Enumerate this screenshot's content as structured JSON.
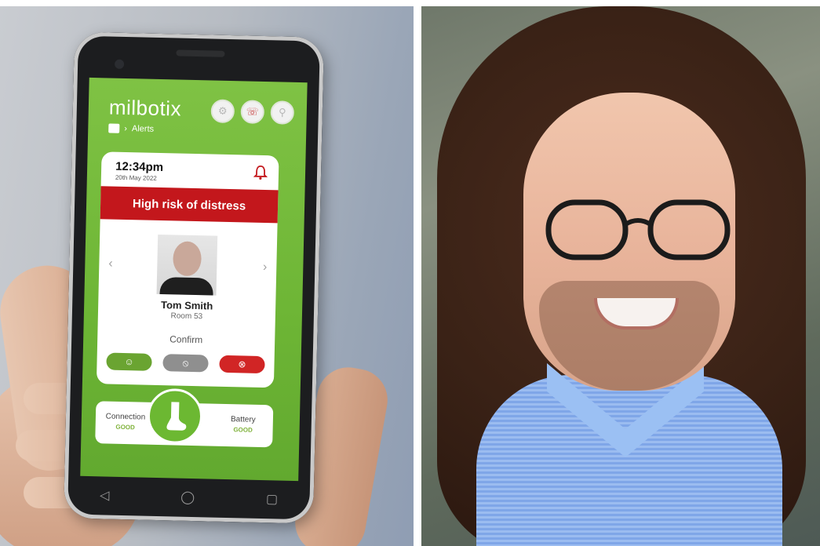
{
  "app": {
    "brand": "milbotix",
    "breadcrumb": {
      "current": "Alerts"
    }
  },
  "alert": {
    "time": "12:34pm",
    "date": "20th May 2022",
    "banner": "High risk of distress"
  },
  "resident": {
    "name": "Tom Smith",
    "room": "Room 53"
  },
  "actions": {
    "confirm_label": "Confirm",
    "buttons": [
      {
        "name": "approve",
        "icon": "☺",
        "color": "#6aa431"
      },
      {
        "name": "dismiss",
        "icon": "⦸",
        "color": "#8f8f8f"
      },
      {
        "name": "reject",
        "icon": "⊗",
        "color": "#d12525"
      }
    ]
  },
  "status": {
    "connection_label": "Connection",
    "connection_value": "GOOD",
    "battery_label": "Battery",
    "battery_value": "GOOD"
  },
  "colors": {
    "brand_green": "#6db535",
    "alert_red": "#c3171c"
  },
  "icons": {
    "top_bar": [
      "settings-icon",
      "notifications-icon",
      "profile-icon"
    ],
    "nav": [
      "back-icon",
      "home-icon",
      "recent-apps-icon"
    ]
  }
}
